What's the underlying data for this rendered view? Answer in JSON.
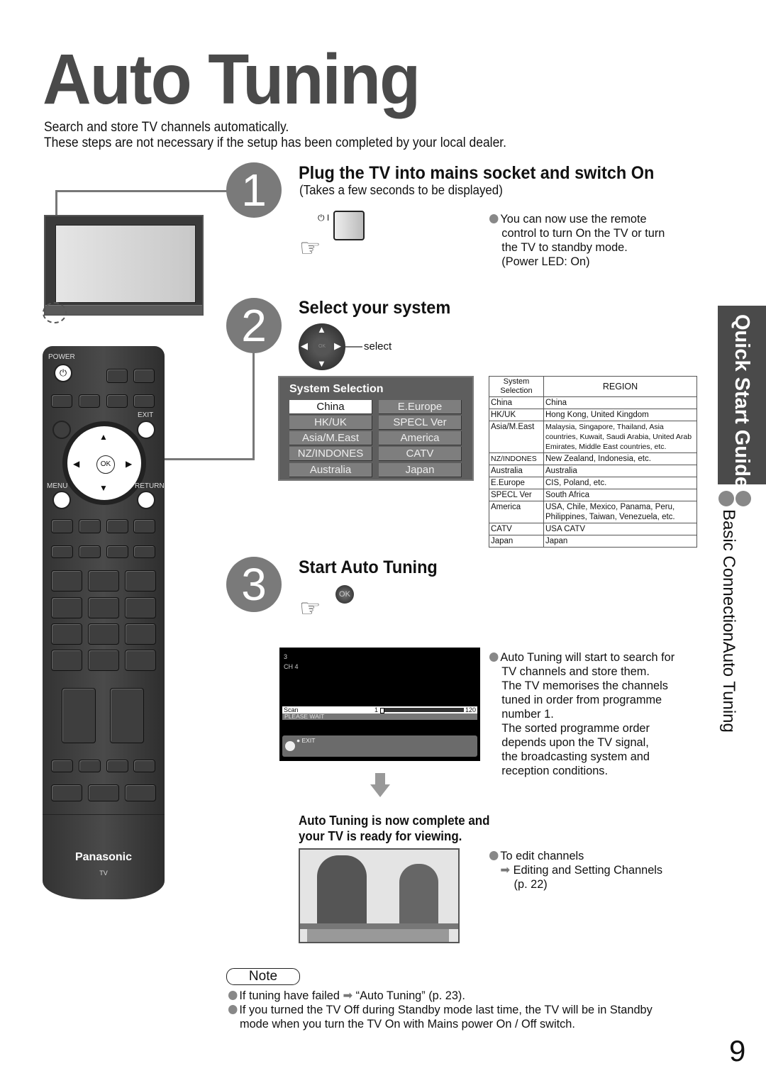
{
  "page": {
    "title": "Auto Tuning",
    "intro": [
      "Search and store TV channels automatically.",
      "These steps are not necessary if the setup has been completed by your local dealer."
    ],
    "page_number": "9"
  },
  "side_tab": {
    "label": "Quick Start Guide",
    "sub_items": [
      "Auto Tuning",
      "Basic Connection"
    ]
  },
  "steps": [
    {
      "number": "1",
      "heading": "Plug the TV into mains socket and switch On",
      "subheading": "(Takes a few seconds to be displayed)",
      "button_symbol": "⏻ I",
      "note": [
        "You can now use the remote",
        "control to turn On the TV or turn",
        "the TV to standby mode.",
        "(Power LED: On)"
      ]
    },
    {
      "number": "2",
      "heading": "Select your system",
      "dpad_label": "select",
      "dpad_ok": "OK"
    },
    {
      "number": "3",
      "heading": "Start Auto Tuning",
      "ok_label": "OK",
      "note": [
        "Auto Tuning will start to search for",
        "TV channels and store them.",
        "The TV memorises the channels",
        "tuned in order from programme",
        "number 1.",
        "The sorted programme order",
        "depends upon the TV signal,",
        "the broadcasting system and",
        "reception conditions."
      ]
    }
  ],
  "system_selection_menu": {
    "title": "System Selection",
    "selected": "China",
    "options_left": [
      "China",
      "HK/UK",
      "Asia/M.East",
      "NZ/INDONES",
      "Australia"
    ],
    "options_right": [
      "E.Europe",
      "SPECL Ver",
      "America",
      "CATV",
      "Japan"
    ]
  },
  "region_table": {
    "headers": [
      "System Selection",
      "REGION"
    ],
    "rows": [
      [
        "China",
        "China"
      ],
      [
        "HK/UK",
        "Hong Kong, United Kingdom"
      ],
      [
        "Asia/M.East",
        "Malaysia, Singapore, Thailand, Asia countries, Kuwait, Saudi Arabia, United Arab Emirates, Middle East countries, etc."
      ],
      [
        "NZ/INDONES",
        "New Zealand, Indonesia, etc."
      ],
      [
        "Australia",
        "Australia"
      ],
      [
        "E.Europe",
        "CIS, Poland, etc."
      ],
      [
        "SPECL Ver",
        "South Africa"
      ],
      [
        "America",
        "USA, Chile, Mexico, Panama, Peru, Philippines, Taiwan, Venezuela, etc."
      ],
      [
        "CATV",
        "USA CATV"
      ],
      [
        "Japan",
        "Japan"
      ]
    ]
  },
  "scan_screen": {
    "programme": "3",
    "channel": "CH 4",
    "scan_label": "Scan",
    "scan_start": "1",
    "scan_end": "120",
    "progress_fraction": 0.0,
    "status": "PLEASE WAIT",
    "exit_label": "EXIT"
  },
  "completion": {
    "heading": [
      "Auto Tuning is now complete and",
      "your TV is ready for viewing."
    ],
    "bullet": "To edit channels",
    "ref_link": "Editing and Setting Channels",
    "ref_page": "(p. 22)"
  },
  "remote": {
    "labels": {
      "power": "POWER",
      "exit": "EXIT",
      "menu": "MENU",
      "return": "RETURN",
      "ok": "OK"
    },
    "brand": "Panasonic",
    "brand_sub": "TV"
  },
  "note": {
    "label": "Note",
    "items": [
      {
        "text": "If tuning have failed",
        "ref": "“Auto Tuning” (p. 23)."
      },
      {
        "text": "If you turned the TV Off during Standby mode last time, the TV will be in Standby",
        "cont": "mode when you turn the TV On with Mains power On / Off switch."
      }
    ]
  }
}
